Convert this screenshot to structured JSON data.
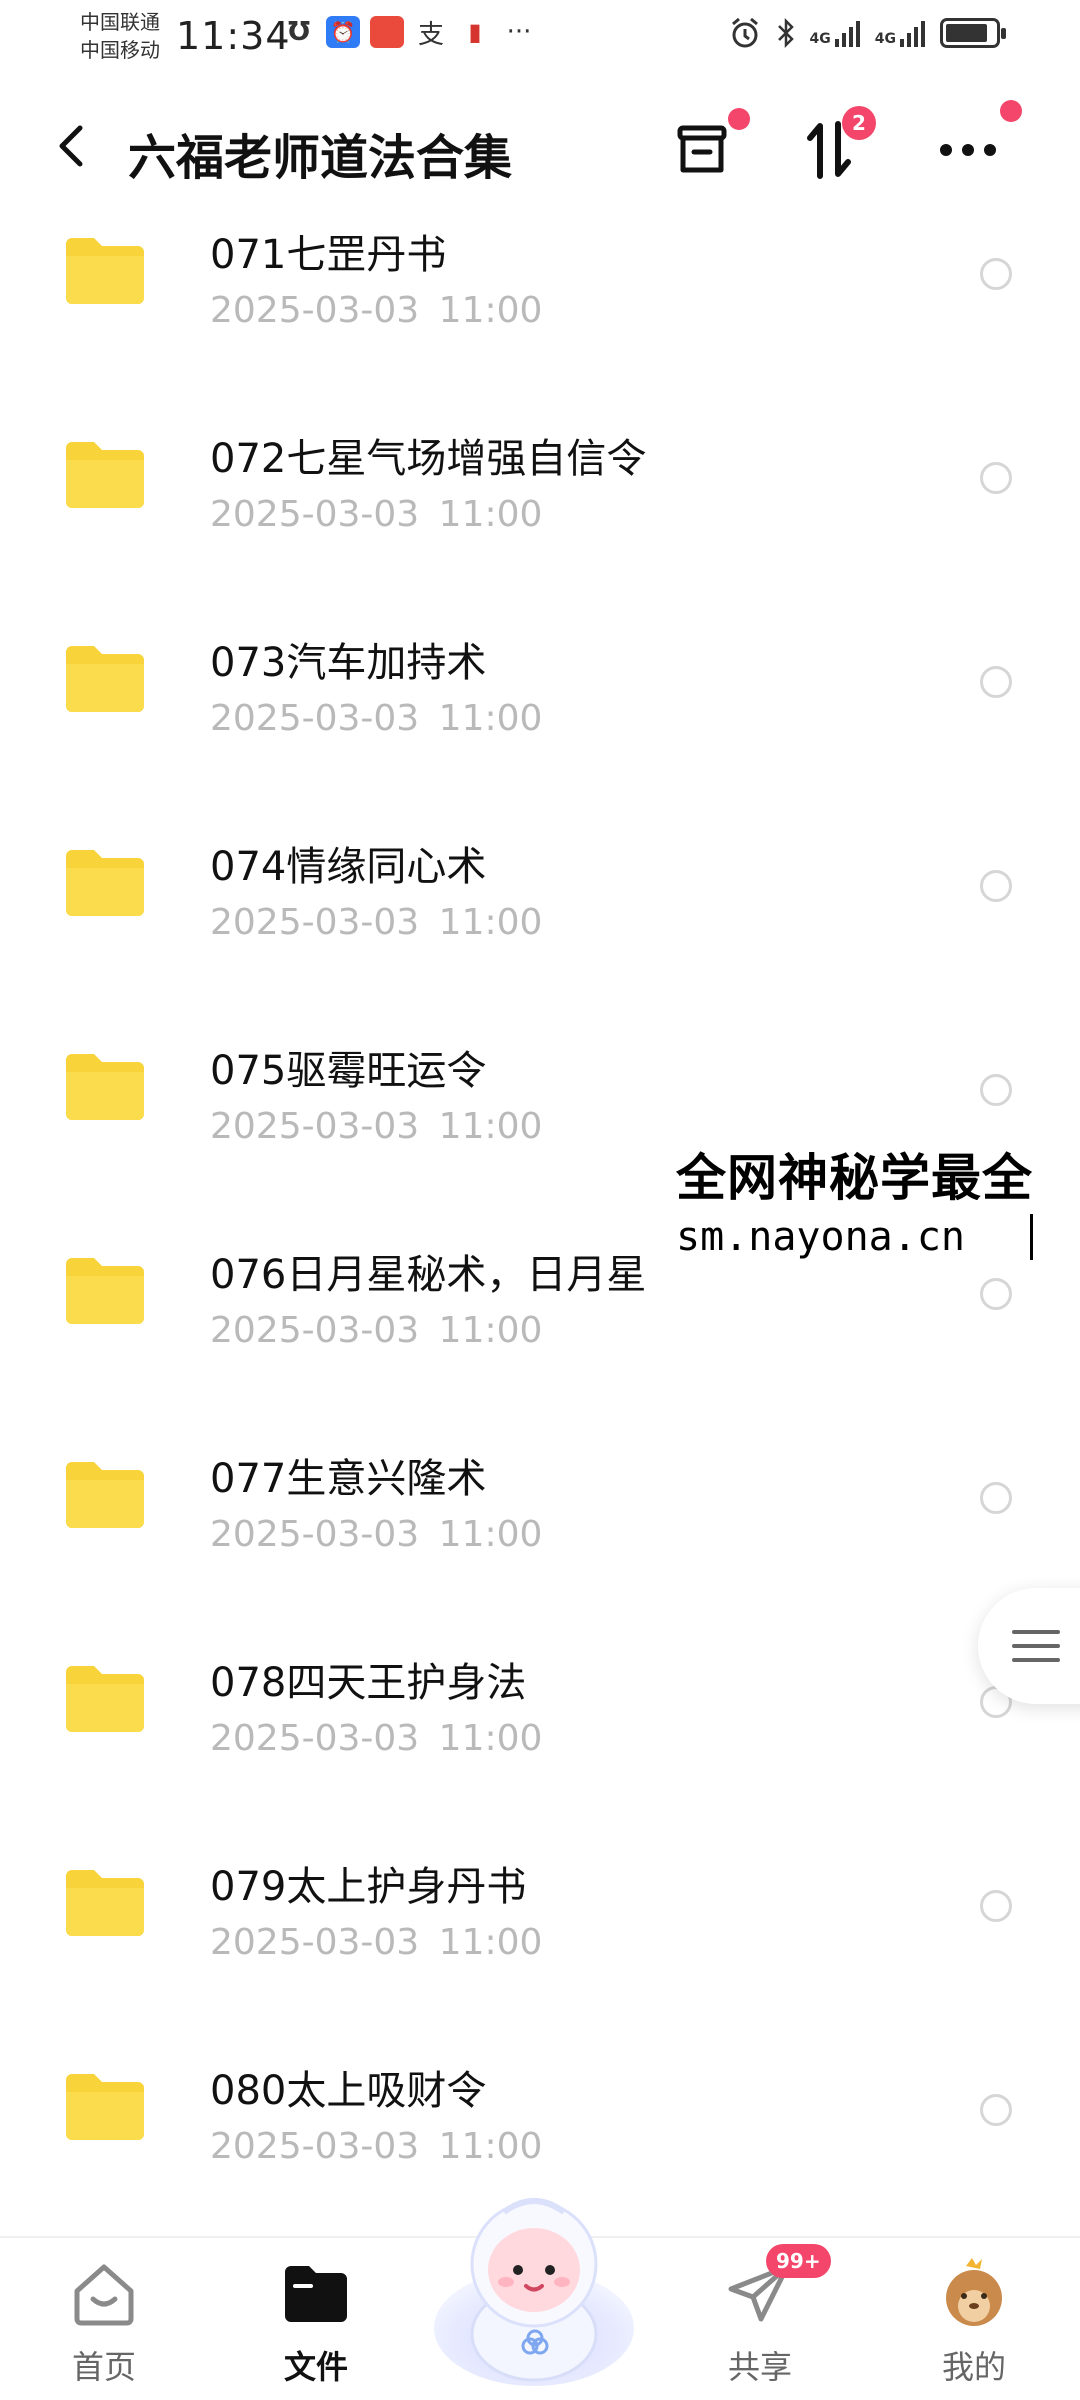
{
  "status_bar": {
    "carrier_1": "中国联通",
    "carrier_2": "中国移动",
    "time": "11:34",
    "signal_1": "4G",
    "signal_2": "4G",
    "battery_level": 0.85
  },
  "header": {
    "title": "六福老师道法合集",
    "sort_badge": "2"
  },
  "files": [
    {
      "name": "071七罡丹书",
      "date": "2025-03-03  11:00"
    },
    {
      "name": "072七星气场增强自信令",
      "date": "2025-03-03  11:00"
    },
    {
      "name": "073汽车加持术",
      "date": "2025-03-03  11:00"
    },
    {
      "name": "074情缘同心术",
      "date": "2025-03-03  11:00"
    },
    {
      "name": "075驱霉旺运令",
      "date": "2025-03-03  11:00"
    },
    {
      "name": "076日月星秘术，日月星",
      "date": "2025-03-03  11:00"
    },
    {
      "name": "077生意兴隆术",
      "date": "2025-03-03  11:00"
    },
    {
      "name": "078四天王护身法",
      "date": "2025-03-03  11:00"
    },
    {
      "name": "079太上护身丹书",
      "date": "2025-03-03  11:00"
    },
    {
      "name": "080太上吸财令",
      "date": "2025-03-03  11:00"
    }
  ],
  "watermark": {
    "line1": "全网神秘学最全",
    "line2": "sm.nayona.cn"
  },
  "bottom_nav": {
    "home": "首页",
    "files": "文件",
    "share": "共享",
    "share_badge": "99+",
    "mine": "我的"
  },
  "colors": {
    "folder": "#f8d33a",
    "badge": "#f3466a",
    "date_text": "#b9b9b9"
  },
  "icons": [
    "back-arrow-icon",
    "transfer-box-icon",
    "sort-icon",
    "more-icon",
    "folder-icon",
    "drawer-menu-icon",
    "home-icon",
    "files-icon",
    "share-paper-plane-icon",
    "profile-avatar-icon"
  ]
}
